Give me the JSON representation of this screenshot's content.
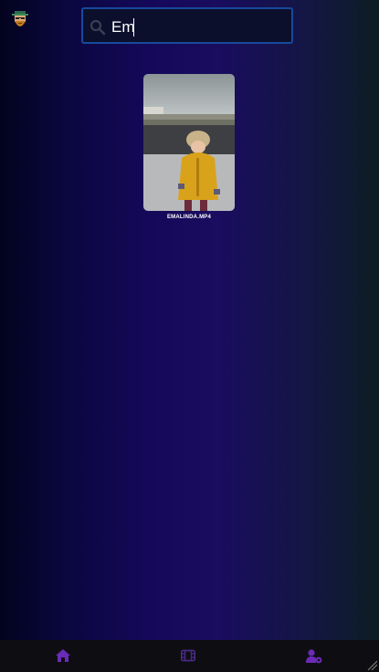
{
  "header": {
    "avatar_icon": "bearded-man-avatar-icon",
    "search": {
      "value": "Em",
      "placeholder": "",
      "icon": "search-icon"
    }
  },
  "results": [
    {
      "title": "EMALINDA.MP4",
      "thumbnail": "child-in-yellow-coat-thumbnail"
    }
  ],
  "nav": {
    "items": [
      {
        "icon": "home-icon"
      },
      {
        "icon": "film-icon"
      },
      {
        "icon": "user-settings-icon"
      }
    ],
    "accent": "#6a2bb8"
  },
  "colors": {
    "search_border": "#174a9b",
    "nav_background": "#0e0e12"
  }
}
